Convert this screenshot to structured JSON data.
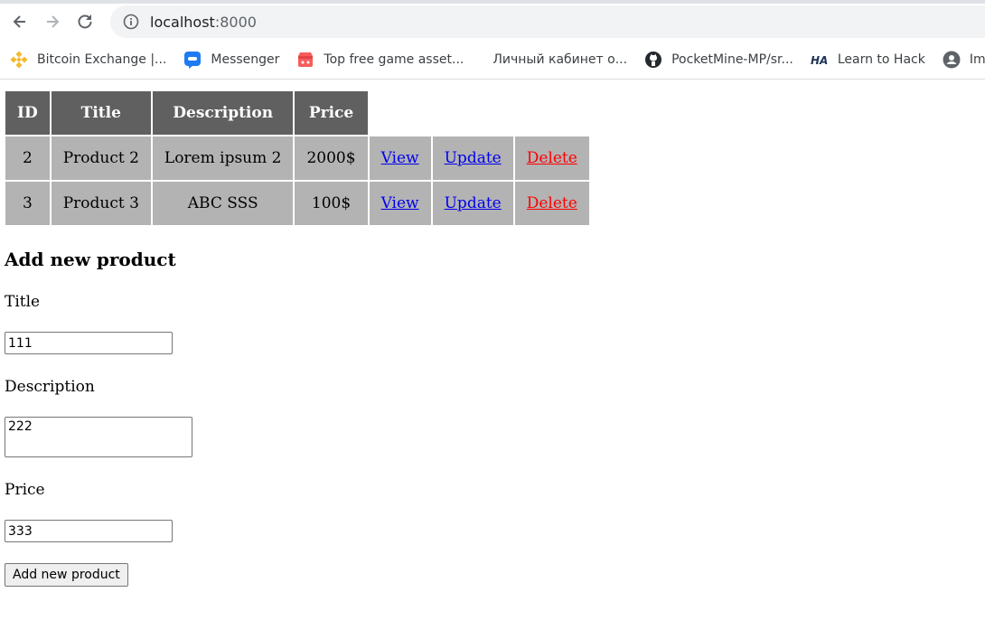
{
  "browser": {
    "url_host": "localhost",
    "url_port": ":8000",
    "bookmarks": [
      {
        "label": "Bitcoin Exchange |...",
        "icon": "binance-icon"
      },
      {
        "label": "Messenger",
        "icon": "messenger-icon"
      },
      {
        "label": "Top free game asset...",
        "icon": "itchio-icon"
      },
      {
        "label": "Личный кабинет о...",
        "icon": ""
      },
      {
        "label": "PocketMine-MP/sr...",
        "icon": "github-icon"
      },
      {
        "label": "Learn to Hack",
        "icon": "ha-icon"
      },
      {
        "label": "Image",
        "icon": "profile-icon"
      }
    ],
    "colors": {
      "binance": "#f3ba2f",
      "messenger": "#1e7bf2",
      "itchio": "#fa5c5c",
      "ha": "#1d3557"
    }
  },
  "table": {
    "headers": [
      "ID",
      "Title",
      "Description",
      "Price"
    ],
    "rows": [
      {
        "id": "2",
        "title": "Product 2",
        "description": "Lorem ipsum 2",
        "price": "2000$",
        "view": "View",
        "update": "Update",
        "delete": "Delete"
      },
      {
        "id": "3",
        "title": "Product 3",
        "description": "ABC SSS",
        "price": "100$",
        "view": "View",
        "update": "Update",
        "delete": "Delete"
      }
    ]
  },
  "form": {
    "heading": "Add new product",
    "title_label": "Title",
    "title_value": "111",
    "description_label": "Description",
    "description_value": "222",
    "price_label": "Price",
    "price_value": "333",
    "submit_label": "Add new product"
  }
}
